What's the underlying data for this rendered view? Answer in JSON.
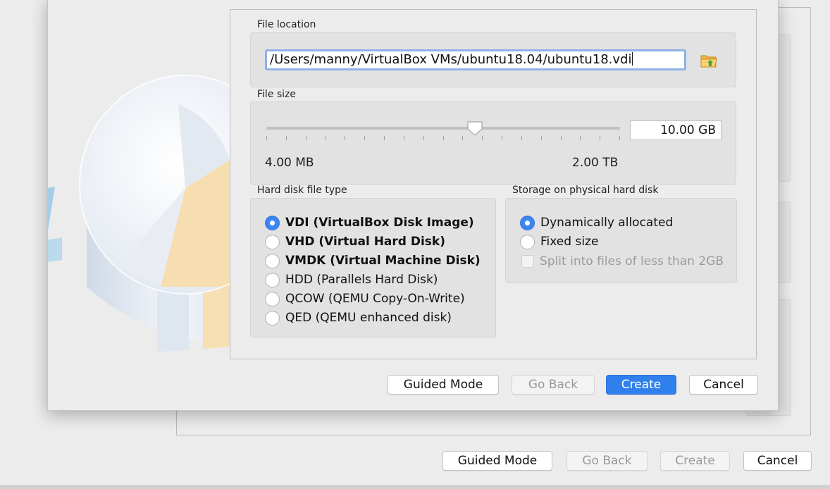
{
  "file_location": {
    "title": "File location",
    "path_value": "/Users/manny/VirtualBox VMs/ubuntu18.04/ubuntu18.vdi",
    "browse_icon": "folder-icon"
  },
  "file_size": {
    "title": "File size",
    "value": "10.00 GB",
    "min_label": "4.00 MB",
    "max_label": "2.00 TB",
    "slider_fraction": 0.59,
    "tick_count": 19
  },
  "disk_type": {
    "title": "Hard disk file type",
    "options": [
      {
        "label": "VDI (VirtualBox Disk Image)",
        "checked": true,
        "bold": true
      },
      {
        "label": "VHD (Virtual Hard Disk)",
        "checked": false,
        "bold": true
      },
      {
        "label": "VMDK (Virtual Machine Disk)",
        "checked": false,
        "bold": true
      },
      {
        "label": "HDD (Parallels Hard Disk)",
        "checked": false,
        "bold": false
      },
      {
        "label": "QCOW (QEMU Copy-On-Write)",
        "checked": false,
        "bold": false
      },
      {
        "label": "QED (QEMU enhanced disk)",
        "checked": false,
        "bold": false
      }
    ]
  },
  "storage": {
    "title": "Storage on physical hard disk",
    "options": [
      {
        "label": "Dynamically allocated",
        "checked": true
      },
      {
        "label": "Fixed size",
        "checked": false
      }
    ],
    "split_label": "Split into files of less than 2GB"
  },
  "buttons": {
    "guided_mode": "Guided Mode",
    "go_back": "Go Back",
    "create": "Create",
    "cancel": "Cancel"
  },
  "background_buttons": {
    "guided_mode": "Guided Mode",
    "go_back": "Go Back",
    "create": "Create",
    "cancel": "Cancel"
  },
  "colors": {
    "accent": "#2f80ed",
    "radio_checked": "#3b86f2",
    "focus_ring": "#8fb1e6"
  }
}
